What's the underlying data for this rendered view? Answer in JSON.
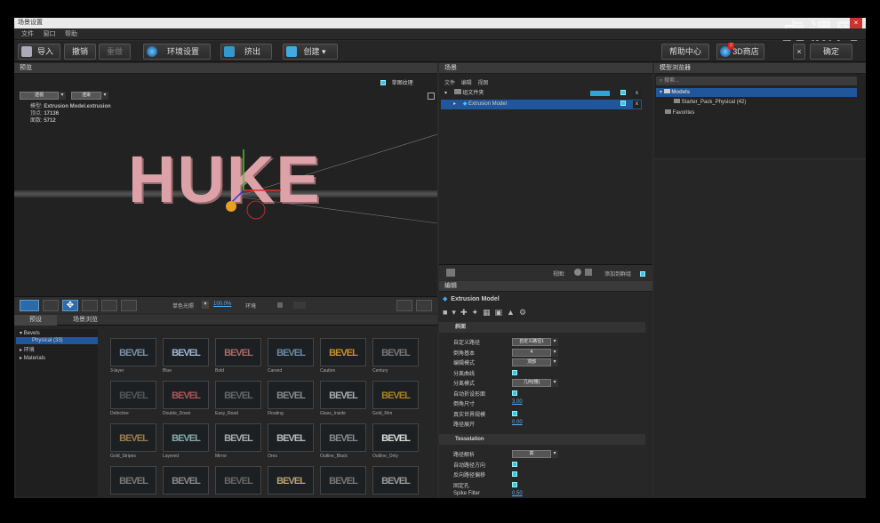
{
  "window": {
    "title": "场景设置"
  },
  "watermark": "虎课网",
  "menu": [
    "文件",
    "窗口",
    "帮助"
  ],
  "toolbar": {
    "import": "导入",
    "undo": "撤销",
    "redo": "重做",
    "env": "环境设置",
    "extrude": "挤出",
    "create": "创建",
    "help": "帮助中心",
    "store": "3D商店",
    "store_badge": "2",
    "confirm": "确定"
  },
  "preview": {
    "tab": "预览",
    "texture_label": "草图纹理",
    "dd1": "透视",
    "dd2": "渲染",
    "info": [
      {
        "k": "模型:",
        "v": "Extrusion Model.extrusion"
      },
      {
        "k": "顶点:",
        "v": "17136"
      },
      {
        "k": "面数:",
        "v": "5712"
      }
    ],
    "text3d": "HUKE",
    "light_label": "单色光照",
    "zoom": "100.0%",
    "env_label": "环境"
  },
  "scene": {
    "tab": "场景",
    "menu": [
      "文件",
      "编辑",
      "视图"
    ],
    "group_label": "组文件夹",
    "model": "Extrusion Model",
    "view_label": "视图:",
    "add_label": "添加到群组"
  },
  "browser": {
    "tab": "模型浏览器",
    "search": "搜索...",
    "items": [
      {
        "label": "Models"
      },
      {
        "label": "Starter_Pack_Physical (42)"
      },
      {
        "label": "Favorites"
      }
    ]
  },
  "bevel_panel": {
    "tabs": [
      "预设",
      "场景浏览"
    ],
    "tree": [
      {
        "label": "Bevels"
      },
      {
        "label": "Physical (33)"
      },
      {
        "label": "环境"
      },
      {
        "label": "Materials"
      }
    ],
    "thumbs": [
      "3-layer",
      "Blue",
      "Bold",
      "Carved",
      "Caution",
      "Century",
      "Defective",
      "Double_Down",
      "Easy_Read",
      "Floating",
      "Glass_Inside",
      "Gold_Rim",
      "Gold_Stripes",
      "Layered",
      "Mirror",
      "Ores",
      "Outline_Black",
      "Outline_Only",
      "",
      "",
      "",
      "",
      "",
      ""
    ]
  },
  "edit": {
    "tab": "编辑",
    "model": "Extrusion Model",
    "section1": "斜面",
    "props": [
      {
        "label": "自定义路径",
        "value": "自定义路径1"
      },
      {
        "label": "倒角基本",
        "value": "4"
      },
      {
        "label": "编辑模式",
        "value": "顶部"
      },
      {
        "label": "分离曲线",
        "value": ""
      },
      {
        "label": "分离模式",
        "value": "几何(慢)"
      },
      {
        "label": "自动折设形面",
        "value": ""
      },
      {
        "label": "倒角尺寸",
        "value": "3.00"
      },
      {
        "label": "真实世界规模",
        "value": ""
      },
      {
        "label": "路径展开",
        "value": "0.00"
      }
    ],
    "section2": "Tesselation",
    "props2": [
      {
        "label": "路径解析",
        "value": "高"
      },
      {
        "label": "自动路径方向",
        "value": ""
      },
      {
        "label": "反向路径偏移",
        "value": ""
      },
      {
        "label": "固定孔",
        "value": ""
      },
      {
        "label": "Spike Filter",
        "value": "0.50"
      }
    ]
  }
}
